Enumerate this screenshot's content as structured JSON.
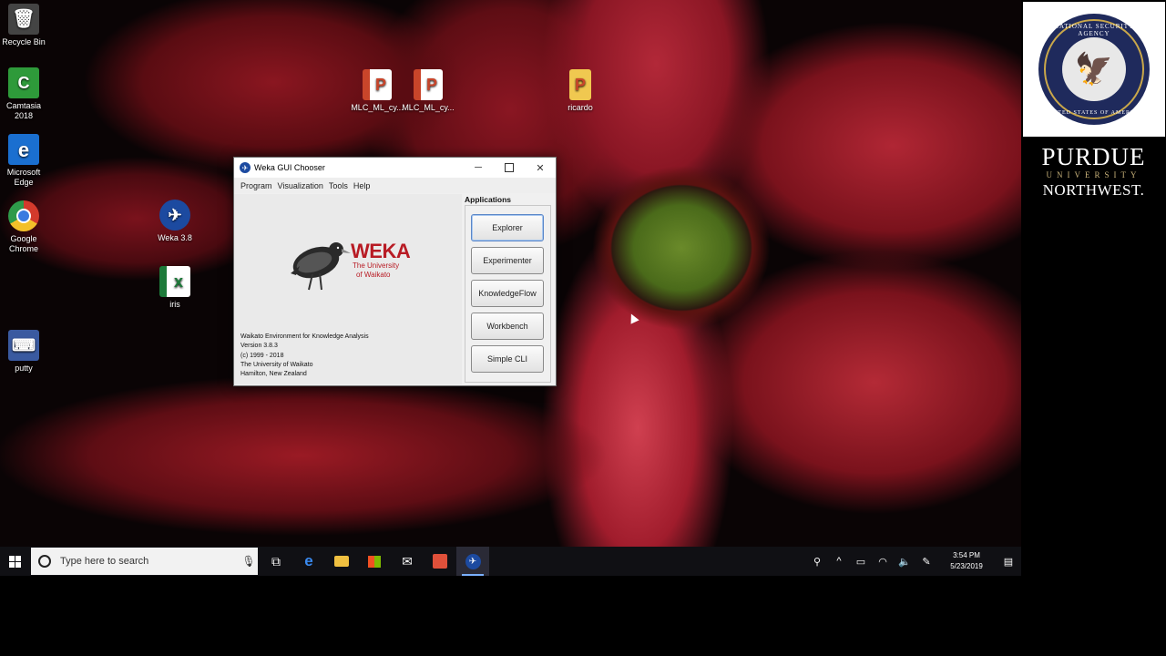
{
  "desktop": {
    "icons": [
      {
        "label": "Recycle Bin",
        "glyph": "🗑",
        "color": "#3a3a3a"
      },
      {
        "label": "Camtasia 2018",
        "glyph": "C",
        "color": "#2e9a3a"
      },
      {
        "label": "Microsoft Edge",
        "glyph": "e",
        "color": "#1a6fd0"
      },
      {
        "label": "Google Chrome",
        "glyph": "●",
        "color": "#d33a2c"
      },
      {
        "label": "putty",
        "glyph": "⌨",
        "color": "#3a5aa0"
      },
      {
        "label": "Weka 3.8",
        "glyph": "✈",
        "color": "#1c4aa0"
      },
      {
        "label": "iris",
        "glyph": "x",
        "color": "#1d7a3a"
      },
      {
        "label": "MLC_ML_cy...",
        "glyph": "P",
        "color": "#c9452a"
      },
      {
        "label": "MLC_ML_cy...",
        "glyph": "P",
        "color": "#c9452a"
      },
      {
        "label": "ricardo",
        "glyph": "P",
        "color": "#e0b040"
      }
    ]
  },
  "branding": {
    "nsa_top": "NATIONAL SECURITY AGENCY",
    "nsa_bottom": "UNITED STATES OF AMERICA",
    "purdue_line1": "PURDUE",
    "purdue_line2": "UNIVERSITY",
    "purdue_line3": "NORTHWEST."
  },
  "weka": {
    "title": "Weka GUI Chooser",
    "menu": [
      "Program",
      "Visualization",
      "Tools",
      "Help"
    ],
    "logo": "WEKA",
    "logo_sub1": "The University",
    "logo_sub2": "of Waikato",
    "info": [
      "Waikato Environment for Knowledge Analysis",
      "Version 3.8.3",
      "(c) 1999 - 2018",
      "The University of Waikato",
      "Hamilton, New Zealand"
    ],
    "apps_label": "Applications",
    "buttons": [
      "Explorer",
      "Experimenter",
      "KnowledgeFlow",
      "Workbench",
      "Simple CLI"
    ]
  },
  "taskbar": {
    "search_placeholder": "Type here to search",
    "time": "3:54 PM",
    "date": "5/23/2019"
  }
}
